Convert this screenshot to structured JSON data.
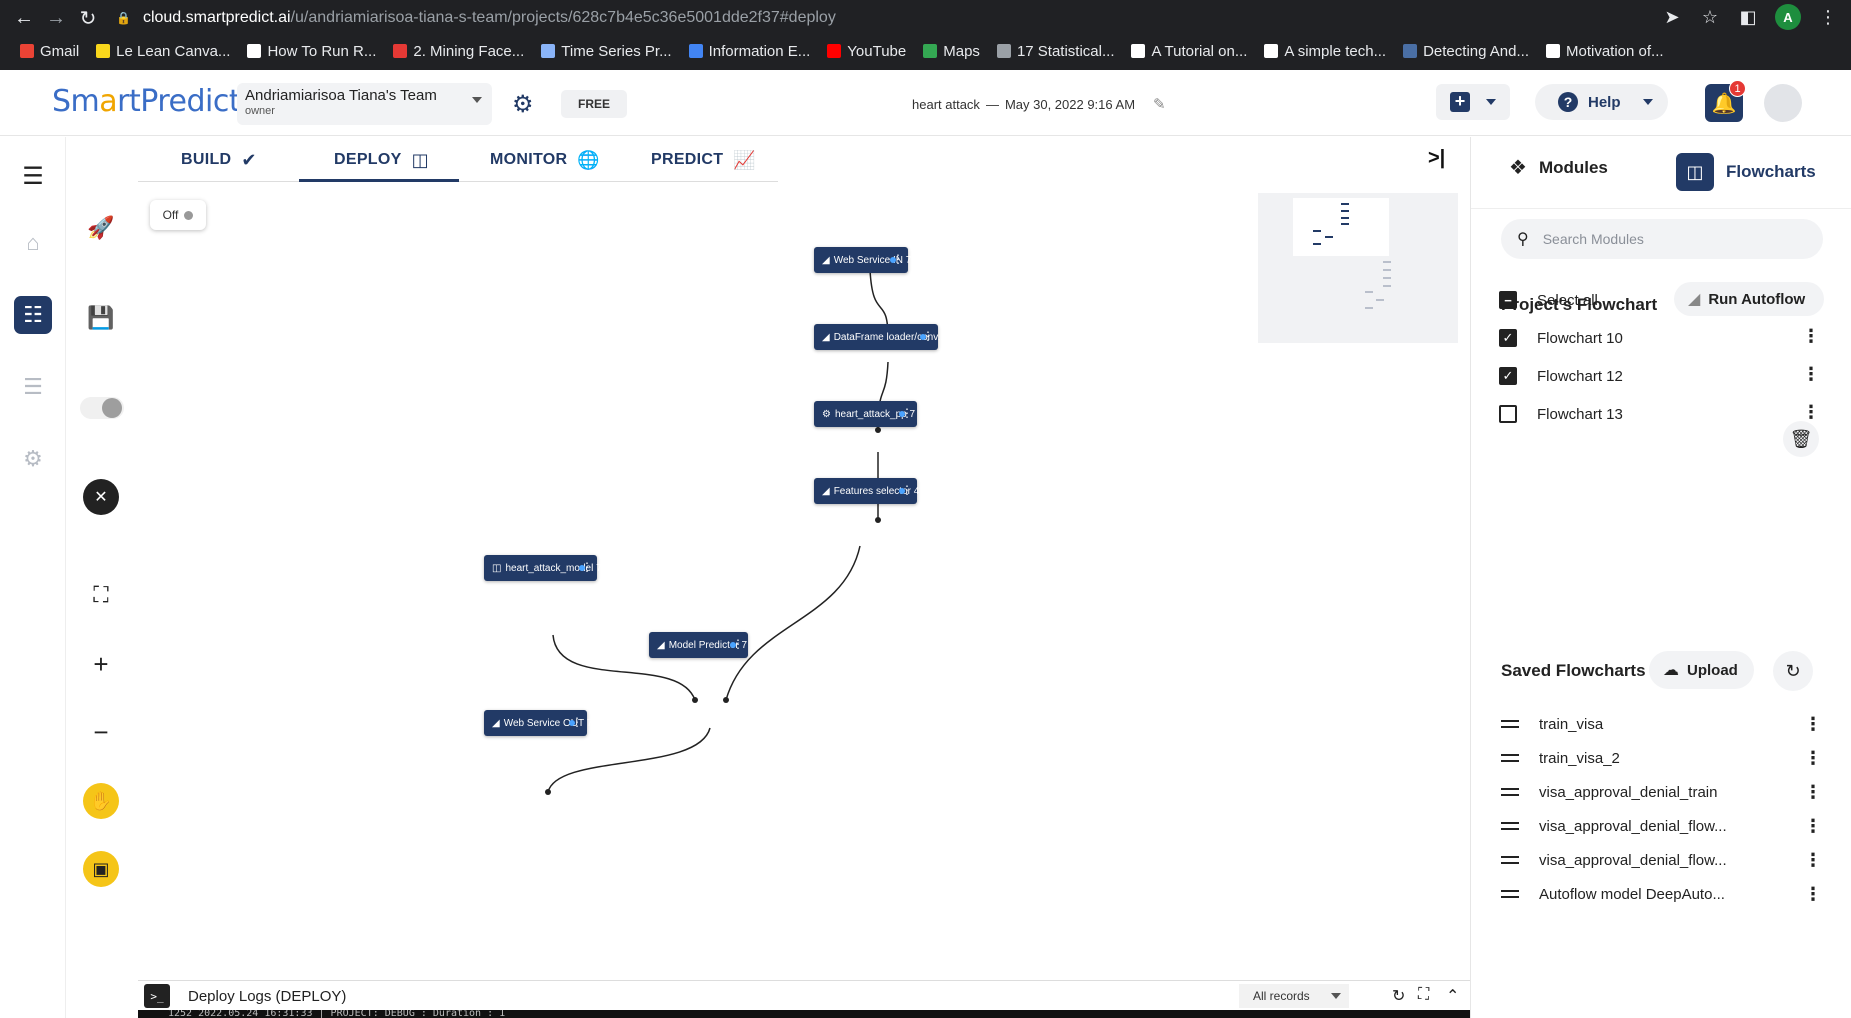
{
  "browser": {
    "url_host": "cloud.smartpredict.ai",
    "url_path": "/u/andriamiarisoa-tiana-s-team/projects/628c7b4e5c36e5001dde2f37#deploy",
    "profile_initial": "A",
    "bookmarks": [
      {
        "label": "Gmail",
        "color": "#ea4335"
      },
      {
        "label": "Le Lean Canva...",
        "color": "#f9d71c"
      },
      {
        "label": "How To Run R...",
        "color": "#ffffff"
      },
      {
        "label": "2. Mining Face...",
        "color": "#e53935"
      },
      {
        "label": "Time Series Pr...",
        "color": "#8ab4f8"
      },
      {
        "label": "Information E...",
        "color": "#4285f4"
      },
      {
        "label": "YouTube",
        "color": "#ff0000"
      },
      {
        "label": "Maps",
        "color": "#34a853"
      },
      {
        "label": "17 Statistical...",
        "color": "#9aa0a6"
      },
      {
        "label": "A Tutorial on...",
        "color": "#ffffff"
      },
      {
        "label": "A simple tech...",
        "color": "#ffffff"
      },
      {
        "label": "Detecting And...",
        "color": "#4a6fa5"
      },
      {
        "label": "Motivation of...",
        "color": "#ffffff"
      }
    ]
  },
  "header": {
    "logo_part1": "Sm",
    "logo_part2": "a",
    "logo_part3": "rtPredict",
    "team_name": "Andriamiarisoa Tiana's Team",
    "team_role": "owner",
    "plan": "FREE",
    "project_name": "heart attack",
    "project_sep": "—",
    "project_date": "May 30, 2022 9:16 AM",
    "help_label": "Help",
    "notification_count": "1"
  },
  "tabs": [
    {
      "label": "BUILD"
    },
    {
      "label": "DEPLOY"
    },
    {
      "label": "MONITOR"
    },
    {
      "label": "PREDICT"
    }
  ],
  "canvas": {
    "switch_label": "Off",
    "nodes": {
      "ws_in": "Web Service IN 7",
      "df_loader": "DataFrame loader/conv...",
      "pp": "heart_attack_pp 7",
      "features": "Features selector 4",
      "model": "heart_attack_model 7",
      "predictor": "Model Predictor 7",
      "ws_out": "Web Service OUT 7"
    }
  },
  "logs": {
    "title": "Deploy Logs (DEPLOY)",
    "records_filter": "All records",
    "partial_line": "1252    2022.05.24 16:31:33 | PROJECT: DEBUG : Duration : 1"
  },
  "right_panel": {
    "tab_modules": "Modules",
    "tab_flowcharts": "Flowcharts",
    "search_placeholder": "Search Modules",
    "project_flowchart_title": "Project's Flowchart",
    "run_autoflow": "Run Autoflow",
    "select_all": "Select all",
    "flowcharts": [
      {
        "label": "Flowchart 10",
        "checked": true
      },
      {
        "label": "Flowchart 12",
        "checked": true
      },
      {
        "label": "Flowchart 13",
        "checked": false
      }
    ],
    "saved_title": "Saved Flowcharts",
    "upload_label": "Upload",
    "saved": [
      {
        "label": "train_visa"
      },
      {
        "label": "train_visa_2"
      },
      {
        "label": "visa_approval_denial_train"
      },
      {
        "label": "visa_approval_denial_flow..."
      },
      {
        "label": "visa_approval_denial_flow..."
      },
      {
        "label": "Autoflow model DeepAuto..."
      }
    ]
  },
  "colors": {
    "brand_navy": "#223a66",
    "brand_blue": "#3a6dc6",
    "brand_gold": "#f0a500",
    "tool_yellow": "#f5c518",
    "port_blue": "#4aa3ff"
  }
}
